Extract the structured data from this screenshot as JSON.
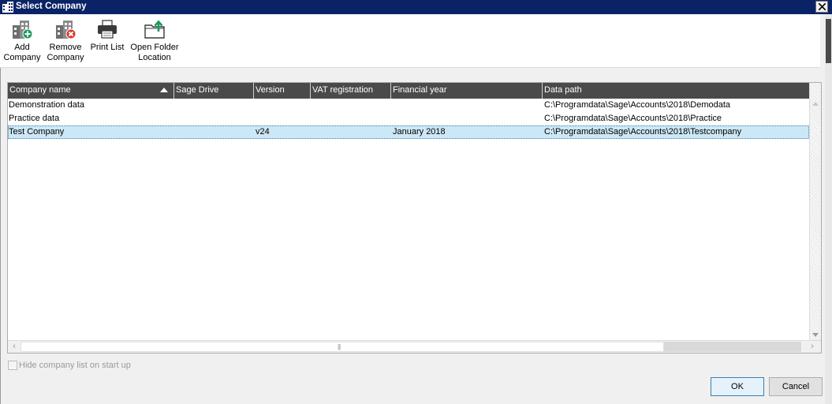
{
  "window": {
    "title": "Select Company"
  },
  "toolbar": {
    "add_company": "Add\nCompany",
    "remove_company": "Remove\nCompany",
    "print_list": "Print List",
    "open_folder": "Open Folder\nLocation"
  },
  "table": {
    "columns": [
      "Company name",
      "Sage Drive",
      "Version",
      "VAT registration",
      "Financial year",
      "Data path"
    ],
    "sort": {
      "column": "Company name",
      "direction": "ascending"
    },
    "rows": [
      {
        "name": "Demonstration data",
        "drive": "",
        "version": "",
        "vat": "",
        "year": "",
        "path": "C:\\Programdata\\Sage\\Accounts\\2018\\Demodata"
      },
      {
        "name": "Practice data",
        "drive": "",
        "version": "",
        "vat": "",
        "year": "",
        "path": "C:\\Programdata\\Sage\\Accounts\\2018\\Practice"
      },
      {
        "name": "Test Company",
        "drive": "",
        "version": "v24",
        "vat": "",
        "year": "January 2018",
        "path": "C:\\Programdata\\Sage\\Accounts\\2018\\Testcompany",
        "selected": true
      }
    ]
  },
  "options": {
    "hide_list_label": "Hide company list on start up",
    "hide_list_checked": false
  },
  "buttons": {
    "ok": "OK",
    "cancel": "Cancel"
  },
  "icons": {
    "add": "building-plus-icon",
    "remove": "building-remove-icon",
    "print": "printer-icon",
    "folder": "folder-up-icon"
  },
  "colors": {
    "titlebar": "#0a2366",
    "header": "#4a4a4a",
    "selection": "#cce8f6",
    "add_accent": "#1a9b5a",
    "remove_accent": "#d9372b"
  }
}
